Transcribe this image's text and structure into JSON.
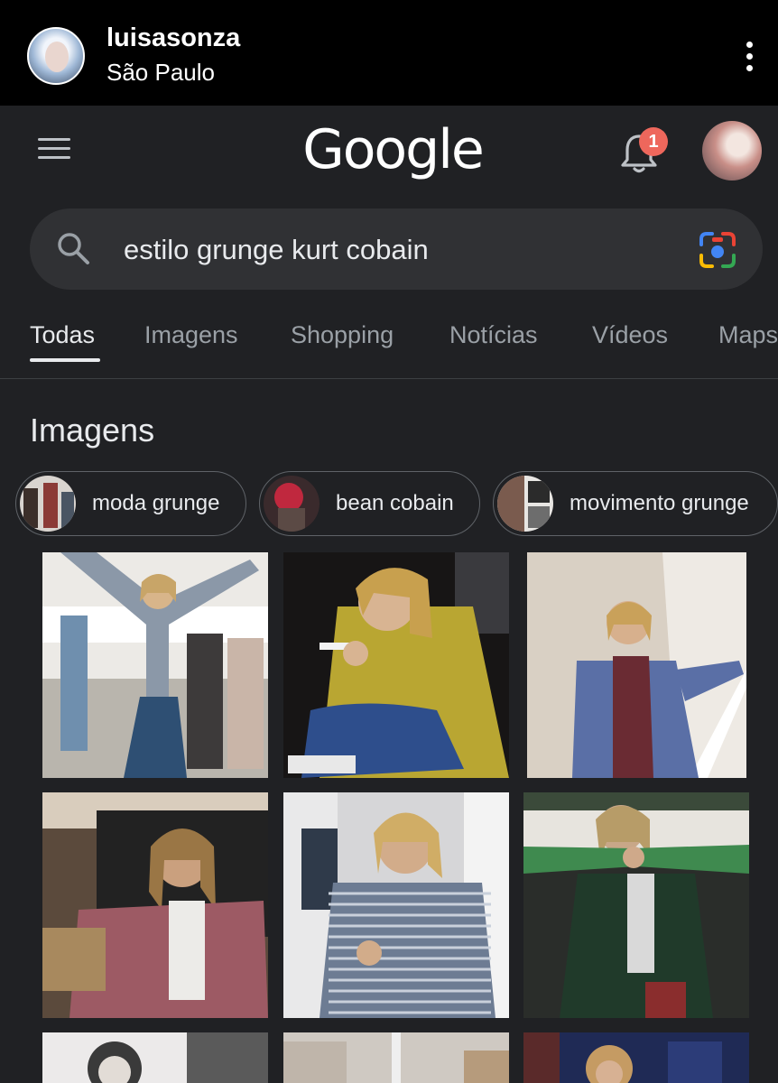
{
  "story": {
    "username": "luisasonza",
    "location": "São Paulo"
  },
  "google": {
    "logo_text": "Google",
    "notification_count": "1"
  },
  "search": {
    "query": "estilo grunge kurt cobain"
  },
  "tabs": [
    {
      "label": "Todas",
      "active": true
    },
    {
      "label": "Imagens",
      "active": false
    },
    {
      "label": "Shopping",
      "active": false
    },
    {
      "label": "Notícias",
      "active": false
    },
    {
      "label": "Vídeos",
      "active": false
    },
    {
      "label": "Maps",
      "active": false
    }
  ],
  "images_section": {
    "title": "Imagens",
    "chips": [
      {
        "label": "moda grunge"
      },
      {
        "label": "bean cobain"
      },
      {
        "label": "movimento grunge"
      }
    ]
  },
  "colors": {
    "background": "#202124",
    "search_bg": "#303134",
    "badge": "#ee675c"
  },
  "icons": [
    "menu-icon",
    "bell-icon",
    "search-icon",
    "lens-icon",
    "more-vertical-icon"
  ]
}
